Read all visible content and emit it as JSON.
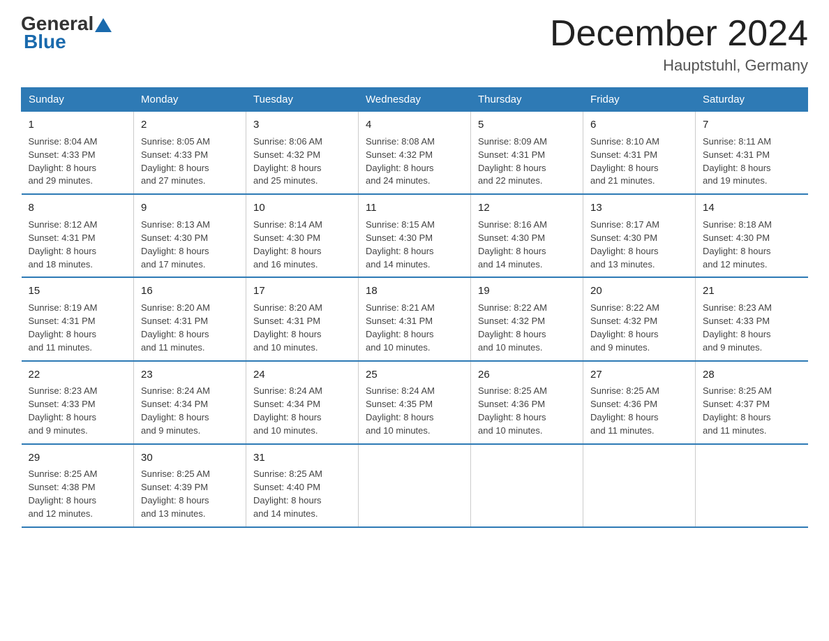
{
  "logo": {
    "general": "General",
    "blue": "Blue"
  },
  "title": "December 2024",
  "subtitle": "Hauptstuhl, Germany",
  "days_header": [
    "Sunday",
    "Monday",
    "Tuesday",
    "Wednesday",
    "Thursday",
    "Friday",
    "Saturday"
  ],
  "weeks": [
    [
      {
        "day": "1",
        "sunrise": "8:04 AM",
        "sunset": "4:33 PM",
        "daylight": "8 hours and 29 minutes."
      },
      {
        "day": "2",
        "sunrise": "8:05 AM",
        "sunset": "4:33 PM",
        "daylight": "8 hours and 27 minutes."
      },
      {
        "day": "3",
        "sunrise": "8:06 AM",
        "sunset": "4:32 PM",
        "daylight": "8 hours and 25 minutes."
      },
      {
        "day": "4",
        "sunrise": "8:08 AM",
        "sunset": "4:32 PM",
        "daylight": "8 hours and 24 minutes."
      },
      {
        "day": "5",
        "sunrise": "8:09 AM",
        "sunset": "4:31 PM",
        "daylight": "8 hours and 22 minutes."
      },
      {
        "day": "6",
        "sunrise": "8:10 AM",
        "sunset": "4:31 PM",
        "daylight": "8 hours and 21 minutes."
      },
      {
        "day": "7",
        "sunrise": "8:11 AM",
        "sunset": "4:31 PM",
        "daylight": "8 hours and 19 minutes."
      }
    ],
    [
      {
        "day": "8",
        "sunrise": "8:12 AM",
        "sunset": "4:31 PM",
        "daylight": "8 hours and 18 minutes."
      },
      {
        "day": "9",
        "sunrise": "8:13 AM",
        "sunset": "4:30 PM",
        "daylight": "8 hours and 17 minutes."
      },
      {
        "day": "10",
        "sunrise": "8:14 AM",
        "sunset": "4:30 PM",
        "daylight": "8 hours and 16 minutes."
      },
      {
        "day": "11",
        "sunrise": "8:15 AM",
        "sunset": "4:30 PM",
        "daylight": "8 hours and 14 minutes."
      },
      {
        "day": "12",
        "sunrise": "8:16 AM",
        "sunset": "4:30 PM",
        "daylight": "8 hours and 14 minutes."
      },
      {
        "day": "13",
        "sunrise": "8:17 AM",
        "sunset": "4:30 PM",
        "daylight": "8 hours and 13 minutes."
      },
      {
        "day": "14",
        "sunrise": "8:18 AM",
        "sunset": "4:30 PM",
        "daylight": "8 hours and 12 minutes."
      }
    ],
    [
      {
        "day": "15",
        "sunrise": "8:19 AM",
        "sunset": "4:31 PM",
        "daylight": "8 hours and 11 minutes."
      },
      {
        "day": "16",
        "sunrise": "8:20 AM",
        "sunset": "4:31 PM",
        "daylight": "8 hours and 11 minutes."
      },
      {
        "day": "17",
        "sunrise": "8:20 AM",
        "sunset": "4:31 PM",
        "daylight": "8 hours and 10 minutes."
      },
      {
        "day": "18",
        "sunrise": "8:21 AM",
        "sunset": "4:31 PM",
        "daylight": "8 hours and 10 minutes."
      },
      {
        "day": "19",
        "sunrise": "8:22 AM",
        "sunset": "4:32 PM",
        "daylight": "8 hours and 10 minutes."
      },
      {
        "day": "20",
        "sunrise": "8:22 AM",
        "sunset": "4:32 PM",
        "daylight": "8 hours and 9 minutes."
      },
      {
        "day": "21",
        "sunrise": "8:23 AM",
        "sunset": "4:33 PM",
        "daylight": "8 hours and 9 minutes."
      }
    ],
    [
      {
        "day": "22",
        "sunrise": "8:23 AM",
        "sunset": "4:33 PM",
        "daylight": "8 hours and 9 minutes."
      },
      {
        "day": "23",
        "sunrise": "8:24 AM",
        "sunset": "4:34 PM",
        "daylight": "8 hours and 9 minutes."
      },
      {
        "day": "24",
        "sunrise": "8:24 AM",
        "sunset": "4:34 PM",
        "daylight": "8 hours and 10 minutes."
      },
      {
        "day": "25",
        "sunrise": "8:24 AM",
        "sunset": "4:35 PM",
        "daylight": "8 hours and 10 minutes."
      },
      {
        "day": "26",
        "sunrise": "8:25 AM",
        "sunset": "4:36 PM",
        "daylight": "8 hours and 10 minutes."
      },
      {
        "day": "27",
        "sunrise": "8:25 AM",
        "sunset": "4:36 PM",
        "daylight": "8 hours and 11 minutes."
      },
      {
        "day": "28",
        "sunrise": "8:25 AM",
        "sunset": "4:37 PM",
        "daylight": "8 hours and 11 minutes."
      }
    ],
    [
      {
        "day": "29",
        "sunrise": "8:25 AM",
        "sunset": "4:38 PM",
        "daylight": "8 hours and 12 minutes."
      },
      {
        "day": "30",
        "sunrise": "8:25 AM",
        "sunset": "4:39 PM",
        "daylight": "8 hours and 13 minutes."
      },
      {
        "day": "31",
        "sunrise": "8:25 AM",
        "sunset": "4:40 PM",
        "daylight": "8 hours and 14 minutes."
      },
      null,
      null,
      null,
      null
    ]
  ],
  "labels": {
    "sunrise": "Sunrise:",
    "sunset": "Sunset:",
    "daylight": "Daylight:"
  }
}
